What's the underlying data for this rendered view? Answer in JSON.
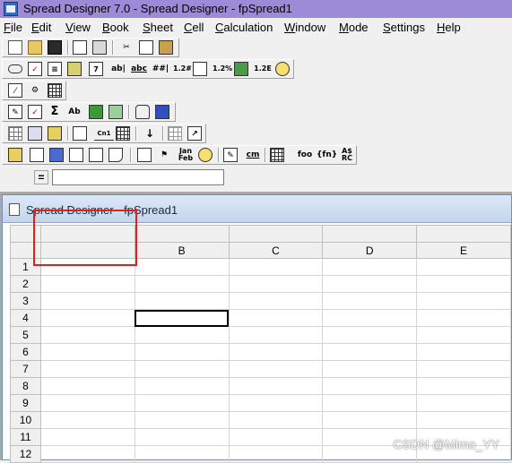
{
  "window": {
    "title": "Spread Designer 7.0 - Spread Designer - fpSpread1"
  },
  "menu": [
    {
      "ul": "F",
      "rest": "ile"
    },
    {
      "ul": "E",
      "rest": "dit"
    },
    {
      "ul": "V",
      "rest": "iew"
    },
    {
      "ul": "B",
      "rest": "ook"
    },
    {
      "ul": "S",
      "rest": "heet"
    },
    {
      "ul": "C",
      "rest": "ell"
    },
    {
      "ul": "C",
      "rest": "alculation"
    },
    {
      "ul": "W",
      "rest": "indow"
    },
    {
      "ul": "M",
      "rest": "ode"
    },
    {
      "ul": "S",
      "rest": "ettings"
    },
    {
      "ul": "H",
      "rest": "elp"
    }
  ],
  "toolbar_icons": {
    "row1": [
      "new-icon",
      "open-icon",
      "save-icon",
      "print-preview-icon",
      "print-icon",
      "cut-icon",
      "copy-icon",
      "paste-icon"
    ],
    "row2": [
      "button-cell-icon",
      "checkbox-cell-icon",
      "combobox-cell-icon",
      "picture-cell-icon",
      "date-cell-icon",
      "edit-cell-icon",
      "text-cell-icon",
      "mask-cell-icon",
      "number-cell-icon",
      "static-text-icon",
      "percent-cell-icon",
      "picture-icon",
      "scientific-cell-icon",
      "time-cell-icon"
    ],
    "row3": [
      "chart-icon",
      "custom-icon",
      "grid-icon"
    ],
    "row4": [
      "edit-icon",
      "check-icon",
      "sum-icon",
      "format-icon",
      "color-icon",
      "merge-icon",
      "lock-icon",
      "select-icon"
    ],
    "row5": [
      "borders-icon",
      "data-icon",
      "image-icon",
      "insert-icon",
      "cell-name-icon",
      "table-icon",
      "sort-icon",
      "grid-lines-icon",
      "link-icon"
    ],
    "row6": [
      "headers-icon",
      "column-icon",
      "row-icon",
      "frame-icon",
      "note-icon",
      "freeze-icon",
      "filter-icon",
      "calendar-icon",
      "comment-icon",
      "properties-icon",
      "cm-icon",
      "table-view-icon",
      "foo-icon",
      "function-icon",
      "a1-r1c1-icon"
    ]
  },
  "toolbar_text": {
    "r2_ab": "ab|",
    "r2_abc": "abc",
    "r2_hash": "##|",
    "r2_12": "1.2#",
    "r2_pct": "1.2%",
    "r2_12e": "1.2E",
    "r4_sigma": "Σ",
    "r4_ab": "Ab",
    "r5_cn": "Cn1",
    "r5_sort": "↓",
    "r6_jan": "Jan",
    "r6_feb": "Feb",
    "r6_cm": "cm",
    "r6_foo": "foo",
    "r6_fn": "{fn}",
    "r6_a": "A$",
    "r6_rc": "RC"
  },
  "formula_bar": {
    "equals_label": "=",
    "value": ""
  },
  "child_window": {
    "title": "Spread Designer - fpSpread1"
  },
  "spreadsheet": {
    "column_letters": [
      "",
      "B",
      "C",
      "D",
      "E"
    ],
    "rows": [
      "1",
      "2",
      "3",
      "4",
      "5",
      "6",
      "7",
      "8",
      "9",
      "10",
      "11",
      "12"
    ],
    "active_cell": "B4"
  },
  "watermark": "CSDN @Mimo_YY",
  "colors": {
    "titlebar": "#9e8bd8",
    "highlight_box": "#e02020"
  }
}
